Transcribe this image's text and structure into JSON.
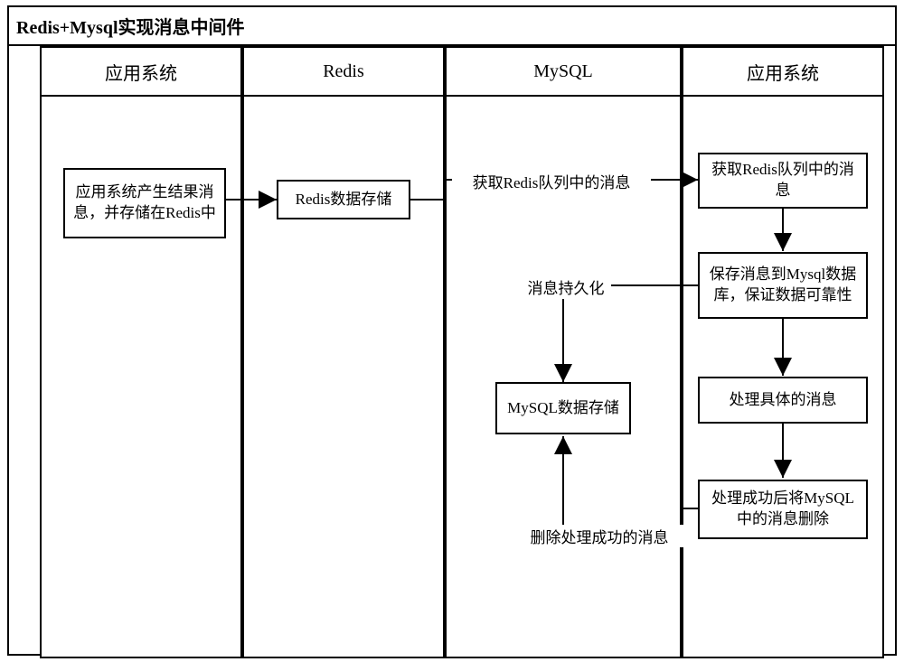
{
  "title": "Redis+Mysql实现消息中间件",
  "lanes": {
    "lane1": "应用系统",
    "lane2": "Redis",
    "lane3": "MySQL",
    "lane4": "应用系统"
  },
  "boxes": {
    "b1": "应用系统产生结果消息，并存储在Redis中",
    "b2": "Redis数据存储",
    "b3": "MySQL数据存储",
    "b4": "获取Redis队列中的消息",
    "b5": "保存消息到Mysql数据库，保证数据可靠性",
    "b6": "处理具体的消息",
    "b7": "处理成功后将MySQL中的消息删除"
  },
  "labels": {
    "l1": "获取Redis队列中的消息",
    "l2": "消息持久化",
    "l3": "删除处理成功的消息"
  }
}
